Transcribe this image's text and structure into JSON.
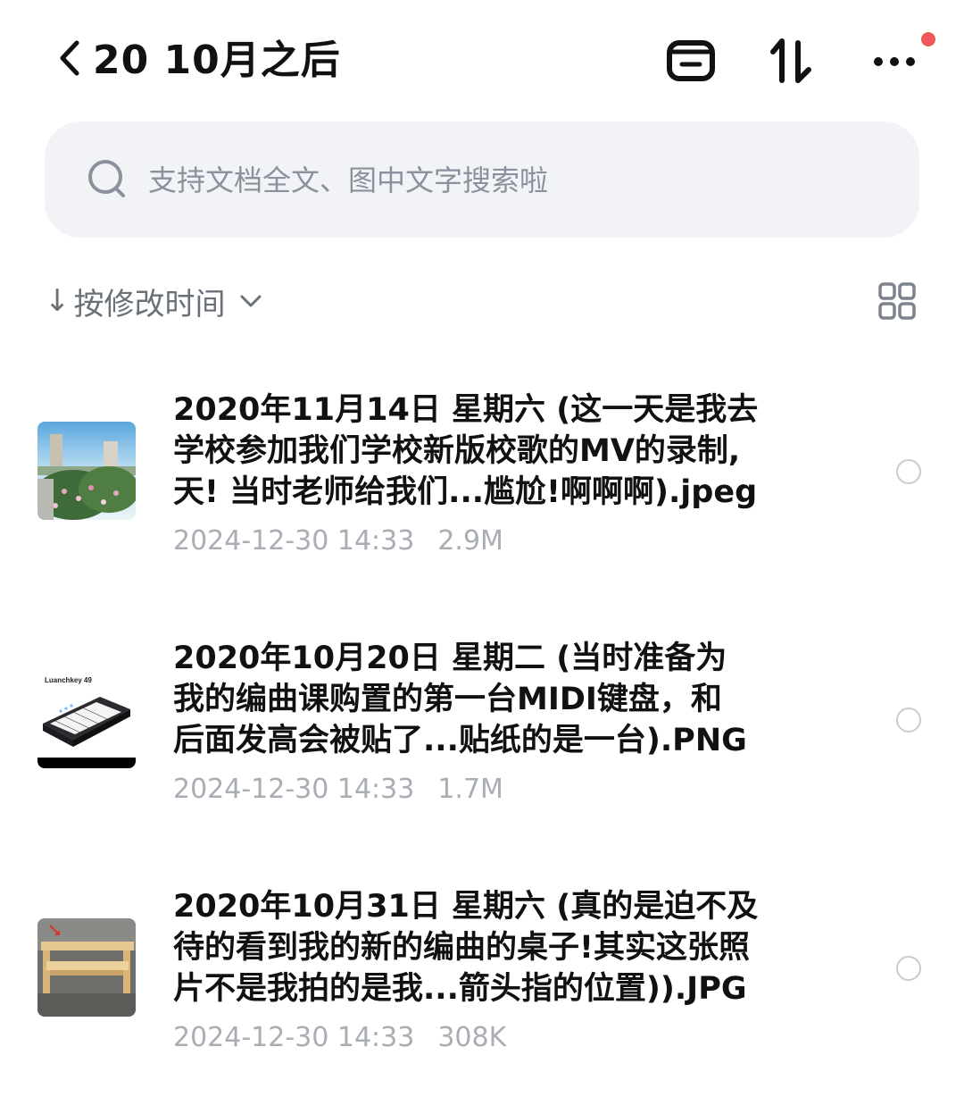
{
  "header": {
    "title": "20 10月之后",
    "icons": [
      "back-chevron-icon",
      "archive-icon",
      "sort-arrows-icon",
      "more-icon"
    ],
    "notification_dot_color": "#f0575a"
  },
  "search": {
    "placeholder": "支持文档全文、图中文字搜索啦"
  },
  "sort": {
    "arrow": "↓",
    "label": "按修改时间",
    "view_toggle_icon": "grid-view-icon"
  },
  "files": [
    {
      "name": "2020年11月14日 星期六 (这一天是我去\n学校参加我们学校新版校歌的MV的录制,\n天! 当时老师给我们...尴尬!啊啊啊).jpeg",
      "date": "2024-12-30 14:33",
      "size": "2.9M",
      "thumbnail": "campus-photo"
    },
    {
      "name": "2020年10月20日 星期二 (当时准备为\n我的编曲课购置的第一台MIDI键盘，和\n后面发高会被贴了...贴纸的是一台).PNG",
      "date": "2024-12-30 14:33",
      "size": "1.7M",
      "thumbnail": "midi-keyboard-image",
      "thumbnail_caption": "Luanchkey 49"
    },
    {
      "name": "2020年10月31日 星期六 (真的是迫不及\n待的看到我的新的编曲的桌子!其实这张照\n片不是我拍的是我...箭头指的位置)).JPG",
      "date": "2024-12-30 14:33",
      "size": "308K",
      "thumbnail": "wooden-desk-photo"
    }
  ]
}
